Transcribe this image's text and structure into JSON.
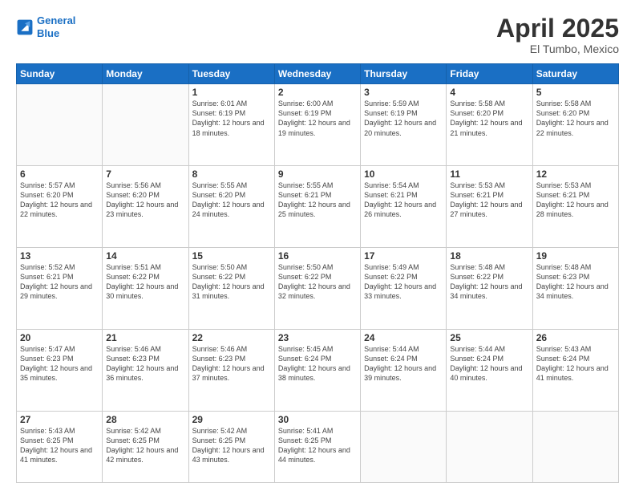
{
  "header": {
    "logo_line1": "General",
    "logo_line2": "Blue",
    "main_title": "April 2025",
    "subtitle": "El Tumbo, Mexico"
  },
  "weekdays": [
    "Sunday",
    "Monday",
    "Tuesday",
    "Wednesday",
    "Thursday",
    "Friday",
    "Saturday"
  ],
  "weeks": [
    [
      {
        "day": "",
        "info": ""
      },
      {
        "day": "",
        "info": ""
      },
      {
        "day": "1",
        "info": "Sunrise: 6:01 AM\nSunset: 6:19 PM\nDaylight: 12 hours and 18 minutes."
      },
      {
        "day": "2",
        "info": "Sunrise: 6:00 AM\nSunset: 6:19 PM\nDaylight: 12 hours and 19 minutes."
      },
      {
        "day": "3",
        "info": "Sunrise: 5:59 AM\nSunset: 6:19 PM\nDaylight: 12 hours and 20 minutes."
      },
      {
        "day": "4",
        "info": "Sunrise: 5:58 AM\nSunset: 6:20 PM\nDaylight: 12 hours and 21 minutes."
      },
      {
        "day": "5",
        "info": "Sunrise: 5:58 AM\nSunset: 6:20 PM\nDaylight: 12 hours and 22 minutes."
      }
    ],
    [
      {
        "day": "6",
        "info": "Sunrise: 5:57 AM\nSunset: 6:20 PM\nDaylight: 12 hours and 22 minutes."
      },
      {
        "day": "7",
        "info": "Sunrise: 5:56 AM\nSunset: 6:20 PM\nDaylight: 12 hours and 23 minutes."
      },
      {
        "day": "8",
        "info": "Sunrise: 5:55 AM\nSunset: 6:20 PM\nDaylight: 12 hours and 24 minutes."
      },
      {
        "day": "9",
        "info": "Sunrise: 5:55 AM\nSunset: 6:21 PM\nDaylight: 12 hours and 25 minutes."
      },
      {
        "day": "10",
        "info": "Sunrise: 5:54 AM\nSunset: 6:21 PM\nDaylight: 12 hours and 26 minutes."
      },
      {
        "day": "11",
        "info": "Sunrise: 5:53 AM\nSunset: 6:21 PM\nDaylight: 12 hours and 27 minutes."
      },
      {
        "day": "12",
        "info": "Sunrise: 5:53 AM\nSunset: 6:21 PM\nDaylight: 12 hours and 28 minutes."
      }
    ],
    [
      {
        "day": "13",
        "info": "Sunrise: 5:52 AM\nSunset: 6:21 PM\nDaylight: 12 hours and 29 minutes."
      },
      {
        "day": "14",
        "info": "Sunrise: 5:51 AM\nSunset: 6:22 PM\nDaylight: 12 hours and 30 minutes."
      },
      {
        "day": "15",
        "info": "Sunrise: 5:50 AM\nSunset: 6:22 PM\nDaylight: 12 hours and 31 minutes."
      },
      {
        "day": "16",
        "info": "Sunrise: 5:50 AM\nSunset: 6:22 PM\nDaylight: 12 hours and 32 minutes."
      },
      {
        "day": "17",
        "info": "Sunrise: 5:49 AM\nSunset: 6:22 PM\nDaylight: 12 hours and 33 minutes."
      },
      {
        "day": "18",
        "info": "Sunrise: 5:48 AM\nSunset: 6:22 PM\nDaylight: 12 hours and 34 minutes."
      },
      {
        "day": "19",
        "info": "Sunrise: 5:48 AM\nSunset: 6:23 PM\nDaylight: 12 hours and 34 minutes."
      }
    ],
    [
      {
        "day": "20",
        "info": "Sunrise: 5:47 AM\nSunset: 6:23 PM\nDaylight: 12 hours and 35 minutes."
      },
      {
        "day": "21",
        "info": "Sunrise: 5:46 AM\nSunset: 6:23 PM\nDaylight: 12 hours and 36 minutes."
      },
      {
        "day": "22",
        "info": "Sunrise: 5:46 AM\nSunset: 6:23 PM\nDaylight: 12 hours and 37 minutes."
      },
      {
        "day": "23",
        "info": "Sunrise: 5:45 AM\nSunset: 6:24 PM\nDaylight: 12 hours and 38 minutes."
      },
      {
        "day": "24",
        "info": "Sunrise: 5:44 AM\nSunset: 6:24 PM\nDaylight: 12 hours and 39 minutes."
      },
      {
        "day": "25",
        "info": "Sunrise: 5:44 AM\nSunset: 6:24 PM\nDaylight: 12 hours and 40 minutes."
      },
      {
        "day": "26",
        "info": "Sunrise: 5:43 AM\nSunset: 6:24 PM\nDaylight: 12 hours and 41 minutes."
      }
    ],
    [
      {
        "day": "27",
        "info": "Sunrise: 5:43 AM\nSunset: 6:25 PM\nDaylight: 12 hours and 41 minutes."
      },
      {
        "day": "28",
        "info": "Sunrise: 5:42 AM\nSunset: 6:25 PM\nDaylight: 12 hours and 42 minutes."
      },
      {
        "day": "29",
        "info": "Sunrise: 5:42 AM\nSunset: 6:25 PM\nDaylight: 12 hours and 43 minutes."
      },
      {
        "day": "30",
        "info": "Sunrise: 5:41 AM\nSunset: 6:25 PM\nDaylight: 12 hours and 44 minutes."
      },
      {
        "day": "",
        "info": ""
      },
      {
        "day": "",
        "info": ""
      },
      {
        "day": "",
        "info": ""
      }
    ]
  ]
}
